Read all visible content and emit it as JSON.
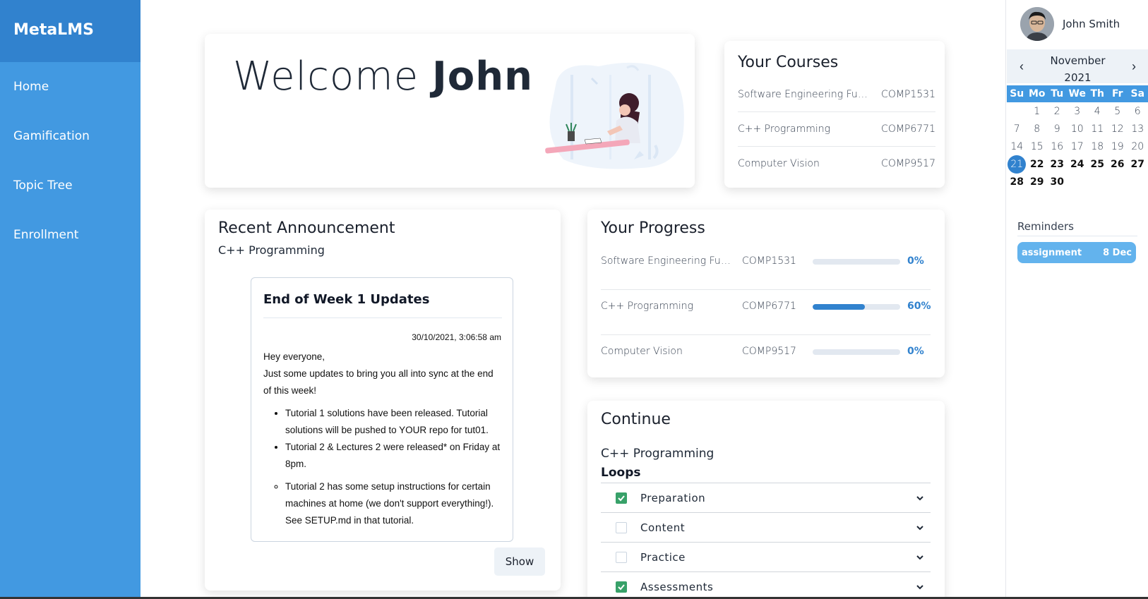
{
  "app": {
    "name": "MetaLMS"
  },
  "sidebar": {
    "items": [
      {
        "label": "Home"
      },
      {
        "label": "Gamification"
      },
      {
        "label": "Topic Tree"
      },
      {
        "label": "Enrollment"
      }
    ]
  },
  "welcome": {
    "greeting": "Welcome",
    "name": "John"
  },
  "courses": {
    "title": "Your Courses",
    "items": [
      {
        "name": "Software Engineering Fundamentals",
        "code": "COMP1531"
      },
      {
        "name": "C++ Programming",
        "code": "COMP6771"
      },
      {
        "name": "Computer Vision",
        "code": "COMP9517"
      }
    ]
  },
  "announcement": {
    "title": "Recent Announcement",
    "course": "C++ Programming",
    "post_title": "End of Week 1 Updates",
    "date": "30/10/2021, 3:06:58 am",
    "greeting": "Hey everyone,",
    "intro": "Just some updates to bring you all into sync at the end of this week!",
    "bullets": [
      "Tutorial 1 solutions have been released. Tutorial solutions will be pushed to YOUR repo for tut01.",
      "Tutorial 2 & Lectures 2 were released* on Friday at 8pm."
    ],
    "sub_bullets": [
      "Tutorial 2 has some setup instructions for certain machines at home (we don't support everything!). See SETUP.md in that tutorial."
    ],
    "show_label": "Show"
  },
  "progress": {
    "title": "Your Progress",
    "items": [
      {
        "name": "Software Engineering Fundamentals",
        "code": "COMP1531",
        "percent": 0,
        "label": "0%"
      },
      {
        "name": "C++ Programming",
        "code": "COMP6771",
        "percent": 60,
        "label": "60%"
      },
      {
        "name": "Computer Vision",
        "code": "COMP9517",
        "percent": 0,
        "label": "0%"
      }
    ]
  },
  "continue": {
    "title": "Continue",
    "course": "C++ Programming",
    "topic": "Loops",
    "sections": [
      {
        "label": "Preparation",
        "checked": true
      },
      {
        "label": "Content",
        "checked": false
      },
      {
        "label": "Practice",
        "checked": false
      },
      {
        "label": "Assessments",
        "checked": true
      }
    ]
  },
  "user": {
    "name": "John Smith"
  },
  "calendar": {
    "month": "November",
    "year": "2021",
    "prev": "‹",
    "next": "›",
    "weekdays": [
      "Su",
      "Mo",
      "Tu",
      "We",
      "Th",
      "Fr",
      "Sa"
    ],
    "first_weekday_index": 1,
    "days_in_month": 30,
    "today": 21
  },
  "reminders": {
    "title": "Reminders",
    "items": [
      {
        "label": "assignment",
        "date": "8 Dec"
      }
    ]
  },
  "colors": {
    "primary": "#4299e1",
    "brand": "#3182ce",
    "success": "#38a169"
  }
}
